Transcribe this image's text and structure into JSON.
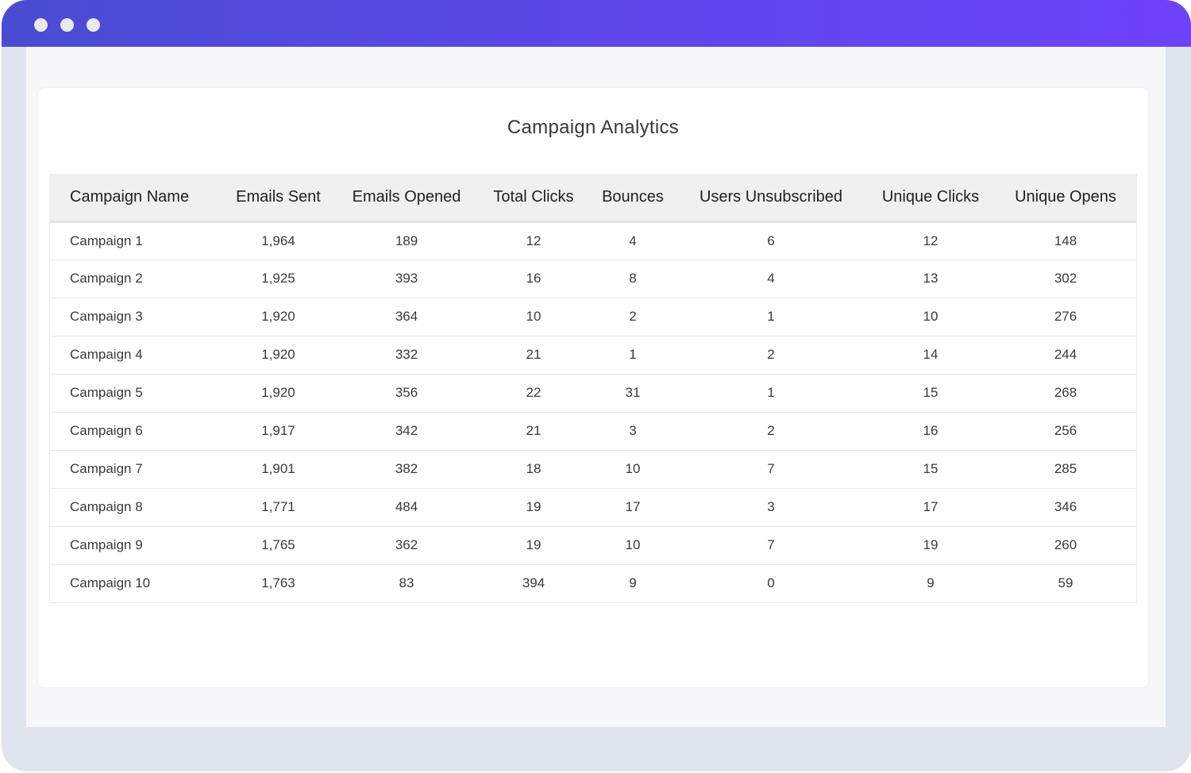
{
  "window": {
    "titlebar_gradient": [
      "#4a4cd3",
      "#6e42fb"
    ],
    "controls": [
      "window-dot-1",
      "window-dot-2",
      "window-dot-3"
    ]
  },
  "card": {
    "title": "Campaign Analytics"
  },
  "table": {
    "columns": [
      "Campaign Name",
      "Emails Sent",
      "Emails Opened",
      "Total Clicks",
      "Bounces",
      "Users Unsubscribed",
      "Unique Clicks",
      "Unique Opens"
    ],
    "rows": [
      [
        "Campaign 1",
        "1,964",
        "189",
        "12",
        "4",
        "6",
        "12",
        "148"
      ],
      [
        "Campaign 2",
        "1,925",
        "393",
        "16",
        "8",
        "4",
        "13",
        "302"
      ],
      [
        "Campaign 3",
        "1,920",
        "364",
        "10",
        "2",
        "1",
        "10",
        "276"
      ],
      [
        "Campaign 4",
        "1,920",
        "332",
        "21",
        "1",
        "2",
        "14",
        "244"
      ],
      [
        "Campaign 5",
        "1,920",
        "356",
        "22",
        "31",
        "1",
        "15",
        "268"
      ],
      [
        "Campaign 6",
        "1,917",
        "342",
        "21",
        "3",
        "2",
        "16",
        "256"
      ],
      [
        "Campaign 7",
        "1,901",
        "382",
        "18",
        "10",
        "7",
        "15",
        "285"
      ],
      [
        "Campaign 8",
        "1,771",
        "484",
        "19",
        "17",
        "3",
        "17",
        "346"
      ],
      [
        "Campaign 9",
        "1,765",
        "362",
        "19",
        "10",
        "7",
        "19",
        "260"
      ],
      [
        "Campaign 10",
        "1,763",
        "83",
        "394",
        "9",
        "0",
        "9",
        "59"
      ]
    ]
  }
}
